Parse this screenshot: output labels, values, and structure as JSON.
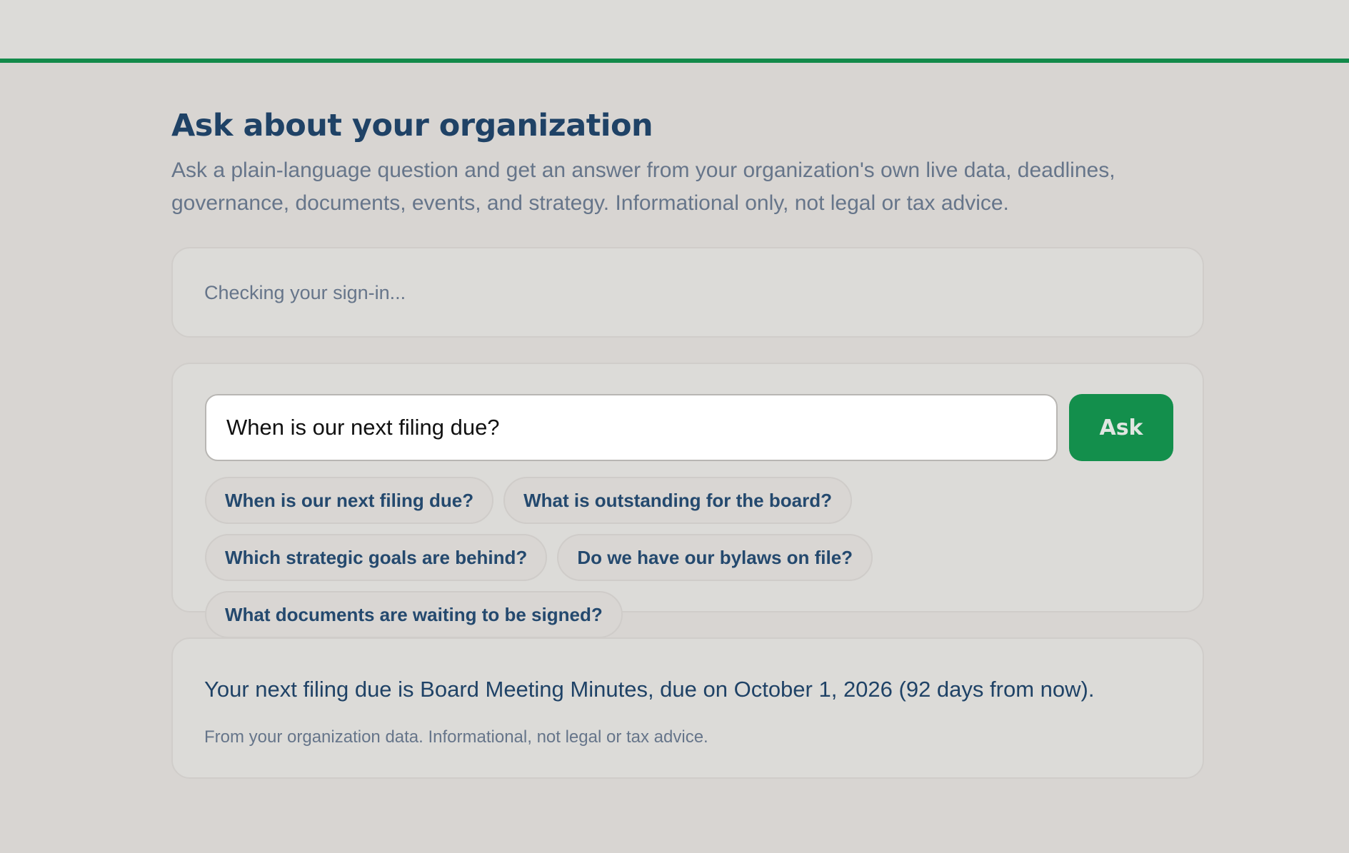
{
  "header": {
    "title": "Ask about your organization",
    "subtitle": "Ask a plain-language question and get an answer from your organization's own live data, deadlines, governance, documents, events, and strategy. Informational only, not legal or tax advice."
  },
  "status": {
    "text": "Checking your sign-in..."
  },
  "ask": {
    "input_value": "When is our next filing due?",
    "button_label": "Ask",
    "suggestions": [
      "When is our next filing due?",
      "What is outstanding for the board?",
      "Which strategic goals are behind?",
      "Do we have our bylaws on file?",
      "What documents are waiting to be signed?"
    ]
  },
  "answer": {
    "text": "Your next filing due is Board Meeting Minutes, due on October 1, 2026 (92 days from now).",
    "note": "From your organization data. Informational, not legal or tax advice."
  },
  "colors": {
    "accent": "#138f4c",
    "heading": "#1f4266",
    "muted": "#66758a",
    "background": "#d8d5d2"
  }
}
